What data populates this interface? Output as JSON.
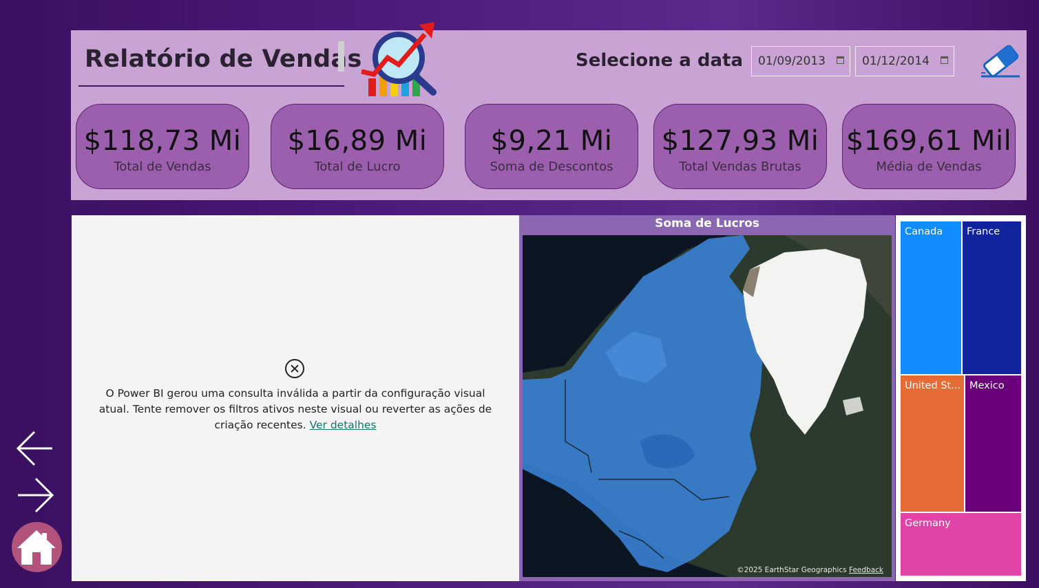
{
  "header": {
    "title": "Relatório de Vendas",
    "date_label": "Selecione a data",
    "date_start": "01/09/2013",
    "date_end": "01/12/2014"
  },
  "kpis": [
    {
      "value": "$118,73 Mi",
      "label": "Total de Vendas"
    },
    {
      "value": "$16,89 Mi",
      "label": "Total de Lucro"
    },
    {
      "value": "$9,21 Mi",
      "label": "Soma de Descontos"
    },
    {
      "value": "$127,93 Mi",
      "label": "Total Vendas Brutas"
    },
    {
      "value": "$169,61 Mil",
      "label": "Média de Vendas"
    }
  ],
  "error_visual": {
    "message": "O Power BI gerou uma consulta inválida a partir da configuração visual atual. Tente remover os filtros ativos neste visual ou reverter as ações de criação recentes.",
    "link": "Ver detalhes"
  },
  "map": {
    "title": "Soma de Lucros",
    "credit": "©2025 EarthStar Geographics",
    "feedback": "Feedback"
  },
  "treemap": {
    "tiles": [
      {
        "label": "Canada",
        "color": "#118dff"
      },
      {
        "label": "France",
        "color": "#12239e"
      },
      {
        "label": "United St...",
        "color": "#e66c37"
      },
      {
        "label": "Mexico",
        "color": "#6b007b"
      },
      {
        "label": "Germany",
        "color": "#e044a7"
      }
    ]
  },
  "colors": {
    "header_panel": "#c9a3d4",
    "kpi_card": "#9b5fae",
    "map_frame": "#8a67b0",
    "home_button": "#b3527a"
  },
  "icons": {
    "logo": "sales-chart-magnifier-icon",
    "clear_filters": "eraser-icon",
    "back": "arrow-left-icon",
    "forward": "arrow-right-icon",
    "home": "home-icon",
    "error": "error-circle-x-icon",
    "calendar": "calendar-icon"
  }
}
